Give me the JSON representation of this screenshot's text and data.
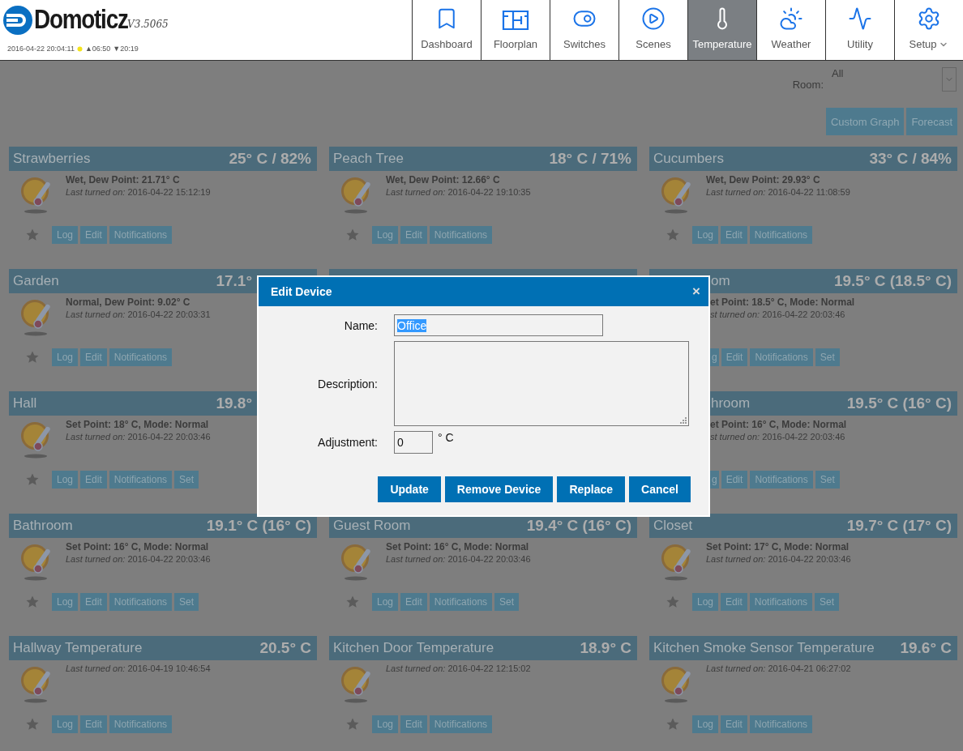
{
  "header": {
    "logo_text": "Domoticz",
    "version": "V3.5065",
    "datetime": "2016-04-22 20:04:11",
    "sunrise": "▲06:50",
    "sunset": "▼20:19"
  },
  "nav": [
    {
      "label": "Dashboard",
      "selected": false,
      "caret": false
    },
    {
      "label": "Floorplan",
      "selected": false,
      "caret": false
    },
    {
      "label": "Switches",
      "selected": false,
      "caret": false
    },
    {
      "label": "Scenes",
      "selected": false,
      "caret": false
    },
    {
      "label": "Temperature",
      "selected": true,
      "caret": false
    },
    {
      "label": "Weather",
      "selected": false,
      "caret": false
    },
    {
      "label": "Utility",
      "selected": false,
      "caret": false
    },
    {
      "label": "Setup",
      "selected": false,
      "caret": true
    }
  ],
  "room_filter": {
    "label": "Room:",
    "value": "All"
  },
  "actions": [
    "Custom Graph",
    "Forecast"
  ],
  "cards": [
    {
      "kind": "full",
      "title": "Strawberries",
      "value": "25° C / 82%",
      "status": "Wet, Dew Point: 21.71° C",
      "last_label": "Last turned on:",
      "last_time": "2016-04-22 15:12:19",
      "buttons": [
        "Log",
        "Edit",
        "Notifications"
      ]
    },
    {
      "kind": "full",
      "title": "Peach Tree",
      "value": "18° C / 71%",
      "status": "Wet, Dew Point: 12.66° C",
      "last_label": "Last turned on:",
      "last_time": "2016-04-22 19:10:35",
      "buttons": [
        "Log",
        "Edit",
        "Notifications"
      ]
    },
    {
      "kind": "full",
      "title": "Cucumbers",
      "value": "33° C / 84%",
      "status": "Wet, Dew Point: 29.93° C",
      "last_label": "Last turned on:",
      "last_time": "2016-04-22 11:08:59",
      "buttons": [
        "Log",
        "Edit",
        "Notifications"
      ]
    },
    {
      "kind": "cut_right",
      "title": "Garden",
      "value": "17.1°",
      "status": "Normal, Dew Point: 9.02° C",
      "last_label": "Last turned on:",
      "last_time": "2016-04-22 20:03:31",
      "buttons": [
        "Log",
        "Edit",
        "Notifications"
      ]
    },
    {
      "kind": "covered"
    },
    {
      "kind": "cut_left",
      "title": "om",
      "value": "19.5° C (18.5° C)",
      "status": "et Point: 18.5° C, Mode: Normal",
      "last_label": "st turned on:",
      "last_time": "2016-04-22 20:03:46",
      "buttons": [
        "g",
        "Edit",
        "Notifications",
        "Set"
      ]
    },
    {
      "kind": "cut_right",
      "title": "Hall",
      "value": "19.8°",
      "status": "Set Point: 18° C, Mode: Normal",
      "last_label": "Last turned on:",
      "last_time": "2016-04-22 20:03:46",
      "buttons": [
        "Log",
        "Edit",
        "Notifications",
        "Set"
      ]
    },
    {
      "kind": "hidden"
    },
    {
      "kind": "cut_left",
      "title": "hroom",
      "value": "19.5° C (16° C)",
      "status": "et Point: 16° C, Mode: Normal",
      "last_label": "st turned on:",
      "last_time": "2016-04-22 20:03:46",
      "buttons": [
        "g",
        "Edit",
        "Notifications",
        "Set"
      ]
    },
    {
      "kind": "full",
      "title": "Bathroom",
      "value": "19.1° C (16° C)",
      "status": "Set Point: 16° C, Mode: Normal",
      "last_label": "Last turned on:",
      "last_time": "2016-04-22 20:03:46",
      "buttons": [
        "Log",
        "Edit",
        "Notifications",
        "Set"
      ]
    },
    {
      "kind": "full",
      "title": "Guest Room",
      "value": "19.4° C (16° C)",
      "status": "Set Point: 16° C, Mode: Normal",
      "last_label": "Last turned on:",
      "last_time": "2016-04-22 20:03:46",
      "buttons": [
        "Log",
        "Edit",
        "Notifications",
        "Set"
      ]
    },
    {
      "kind": "full",
      "title": "Closet",
      "value": "19.7° C (17° C)",
      "status": "Set Point: 17° C, Mode: Normal",
      "last_label": "Last turned on:",
      "last_time": "2016-04-22 20:03:46",
      "buttons": [
        "Log",
        "Edit",
        "Notifications",
        "Set"
      ]
    },
    {
      "kind": "full",
      "title": "Hallway Temperature",
      "value": "20.5° C",
      "last_label": "Last turned on:",
      "last_time": "2016-04-19 10:46:54",
      "buttons": [
        "Log",
        "Edit",
        "Notifications"
      ]
    },
    {
      "kind": "full",
      "title": "Kitchen Door Temperature",
      "value": "18.9° C",
      "last_label": "Last turned on:",
      "last_time": "2016-04-22 12:15:02",
      "buttons": [
        "Log",
        "Edit",
        "Notifications"
      ]
    },
    {
      "kind": "full",
      "title": "Kitchen Smoke Sensor Temperature",
      "value": "19.6° C",
      "last_label": "Last turned on:",
      "last_time": "2016-04-21 06:27:02",
      "buttons": [
        "Log",
        "Edit",
        "Notifications"
      ]
    }
  ],
  "dialog": {
    "title": "Edit Device",
    "close": "×",
    "fields": [
      {
        "kind": "text",
        "label": "Name:",
        "value": "Office",
        "value_selected": true
      },
      {
        "kind": "textarea",
        "label": "Description:"
      },
      {
        "kind": "number",
        "label": "Adjustment:",
        "value": "0",
        "unit": "° C"
      }
    ],
    "buttons": [
      "Update",
      "Remove Device",
      "Replace",
      "Cancel"
    ]
  }
}
